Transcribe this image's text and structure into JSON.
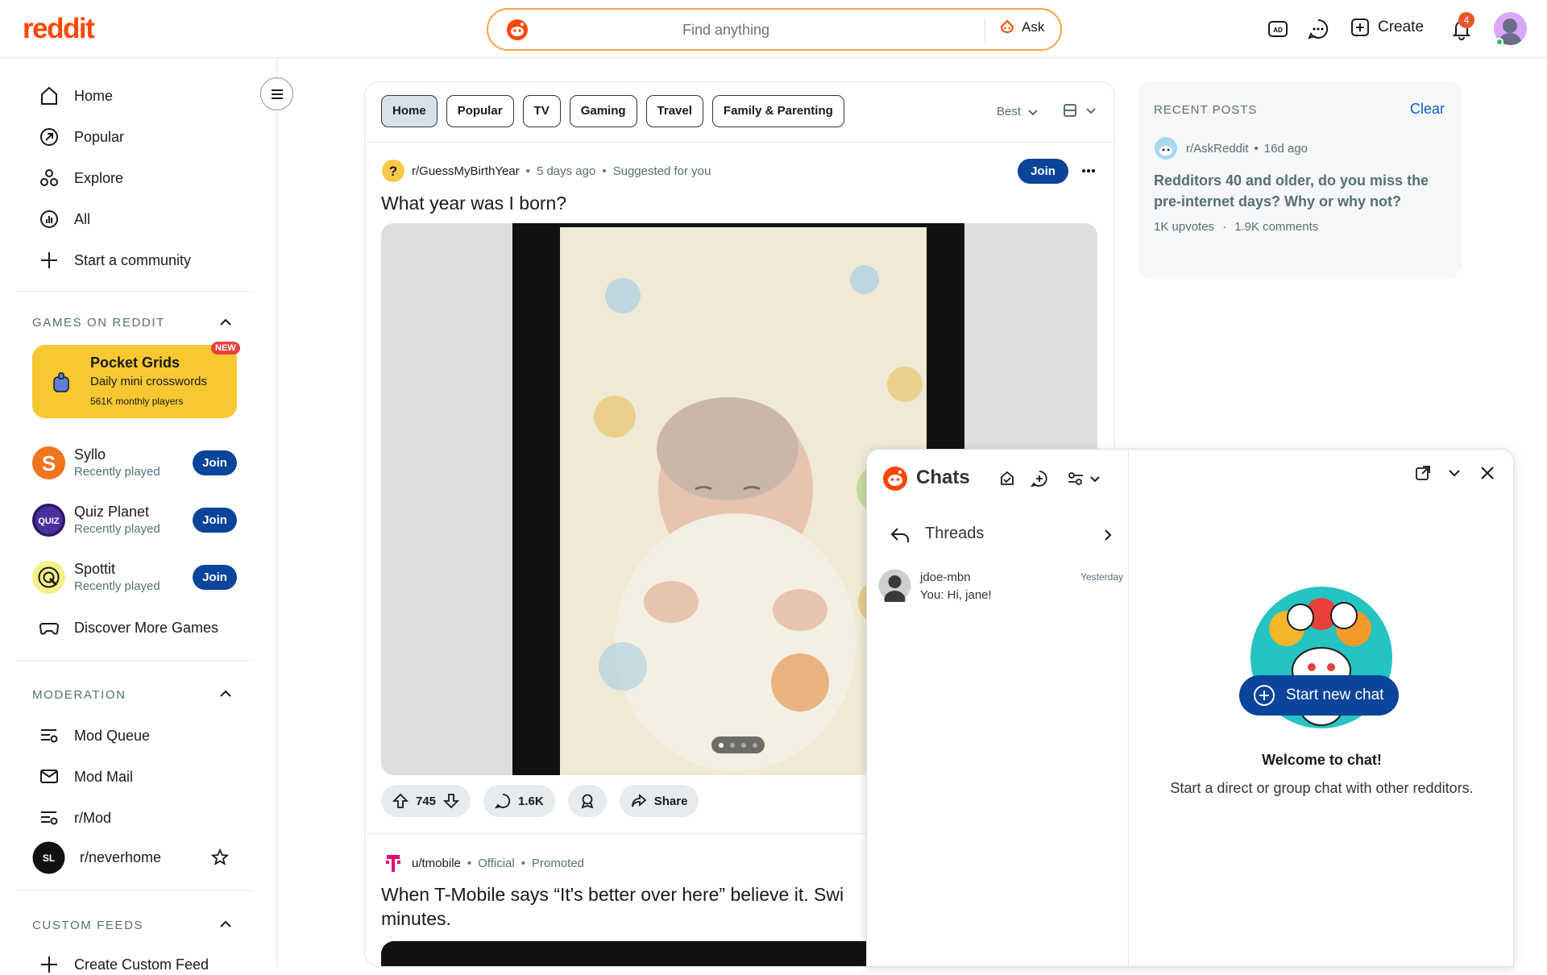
{
  "header": {
    "logo": "reddit",
    "search_placeholder": "Find anything",
    "ask_label": "Ask",
    "create_label": "Create",
    "notification_count": "4"
  },
  "sidebar": {
    "nav": [
      {
        "label": "Home",
        "icon": "home-icon"
      },
      {
        "label": "Popular",
        "icon": "popular-icon"
      },
      {
        "label": "Explore",
        "icon": "explore-icon"
      },
      {
        "label": "All",
        "icon": "all-icon"
      },
      {
        "label": "Start a community",
        "icon": "plus-icon"
      }
    ],
    "games_heading": "GAMES ON REDDIT",
    "featured_game": {
      "title": "Pocket Grids",
      "subtitle": "Daily mini crosswords",
      "players": "561K monthly players",
      "badge": "NEW"
    },
    "games": [
      {
        "name": "Syllo",
        "status": "Recently played",
        "join": "Join"
      },
      {
        "name": "Quiz Planet",
        "status": "Recently played",
        "join": "Join"
      },
      {
        "name": "Spottit",
        "status": "Recently played",
        "join": "Join"
      }
    ],
    "discover_label": "Discover More Games",
    "moderation_heading": "MODERATION",
    "moderation": [
      {
        "label": "Mod Queue"
      },
      {
        "label": "Mod Mail"
      },
      {
        "label": "r/Mod"
      },
      {
        "label": "r/neverhome"
      }
    ],
    "custom_feeds_heading": "CUSTOM FEEDS",
    "create_custom_feed": "Create Custom Feed"
  },
  "feed": {
    "tabs": [
      "Home",
      "Popular",
      "TV",
      "Gaming",
      "Travel",
      "Family & Parenting"
    ],
    "active_tab": "Home",
    "sort_label": "Best",
    "post1": {
      "subreddit": "r/GuessMyBirthYear",
      "time": "5 days ago",
      "suggested": "Suggested for you",
      "join": "Join",
      "title": "What year was I born?",
      "upvotes": "745",
      "comments": "1.6K",
      "share": "Share"
    },
    "post2": {
      "author": "u/tmobile",
      "official": "Official",
      "promoted": "Promoted",
      "title": "When T-Mobile says “It's better over here” believe it. Swi",
      "title2": "minutes."
    }
  },
  "recent_posts": {
    "heading": "RECENT POSTS",
    "clear": "Clear",
    "subreddit": "r/AskReddit",
    "time": "16d ago",
    "title": "Redditors 40 and older, do you miss the pre-internet days? Why or why not?",
    "upvotes": "1K upvotes",
    "comments": "1.9K comments"
  },
  "chat": {
    "title": "Chats",
    "threads_label": "Threads",
    "thread": {
      "user": "jdoe-mbn",
      "time": "Yesterday",
      "preview": "You: Hi, jane!"
    },
    "welcome_title": "Welcome to chat!",
    "welcome_text": "Start a direct or group chat with other redditors.",
    "start_button": "Start new chat"
  },
  "colors": {
    "brand": "#ff4500",
    "join_button": "#0a449b",
    "pocket_grids": "#f8c832"
  }
}
